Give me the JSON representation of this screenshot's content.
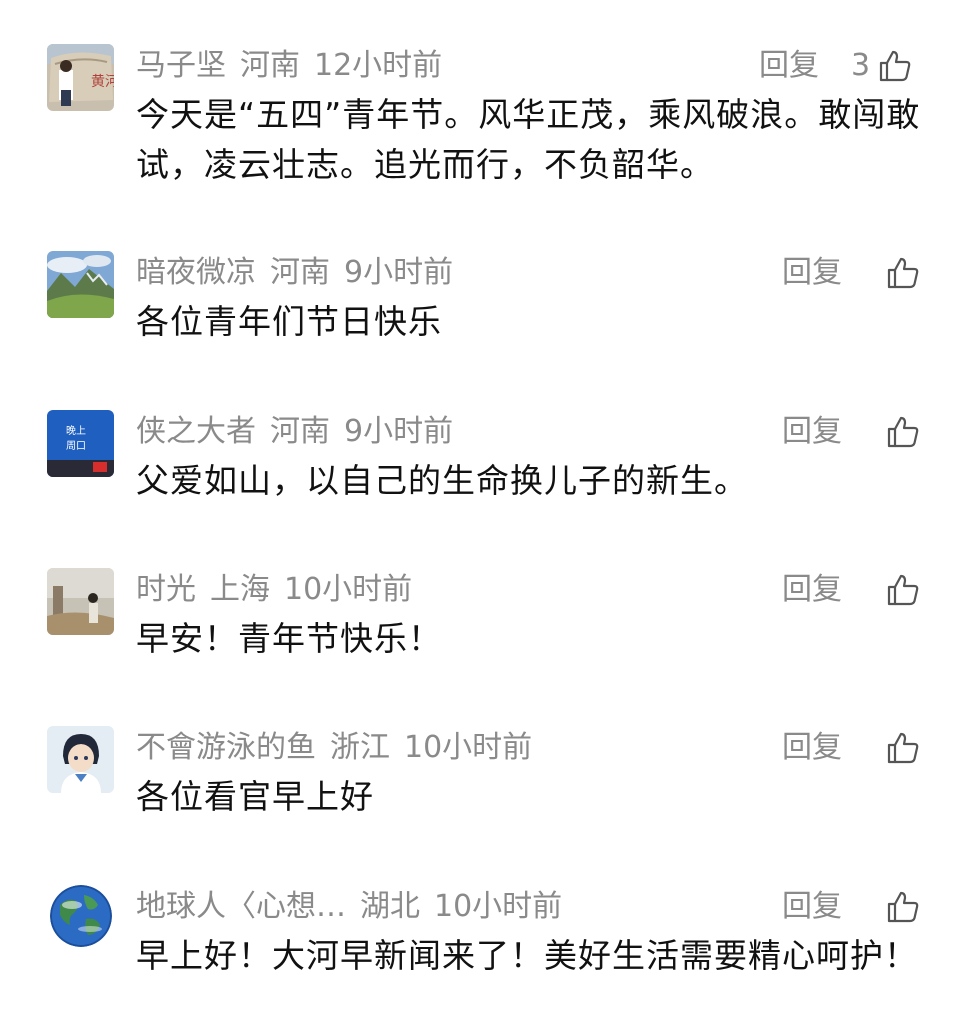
{
  "reply_label": "回复",
  "comments": [
    {
      "user": "马子坚",
      "location": "河南",
      "time": "12小时前",
      "likes": "3",
      "text": "今天是“五四”青年节。风华正茂，乘风破浪。敢闯敢试，凌云壮志。追光而行，不负韶华。",
      "avatar_icon": "stone-monument-avatar",
      "avatar_text": "黄河"
    },
    {
      "user": "暗夜微凉",
      "location": "河南",
      "time": "9小时前",
      "likes": "",
      "text": "各位青年们节日快乐",
      "avatar_icon": "landscape-avatar"
    },
    {
      "user": "侠之大者",
      "location": "河南",
      "time": "9小时前",
      "likes": "",
      "text": "父爱如山，以自己的生命换儿子的新生。",
      "avatar_icon": "news-badge-avatar",
      "avatar_text_1": "晚上",
      "avatar_text_2": "周口"
    },
    {
      "user": "时光",
      "location": "上海",
      "time": "10小时前",
      "likes": "",
      "text": "早安！青年节快乐！",
      "avatar_icon": "photo-avatar"
    },
    {
      "user": "不會游泳的鱼",
      "location": "浙江",
      "time": "10小时前",
      "likes": "",
      "text": "各位看官早上好",
      "avatar_icon": "anime-avatar"
    },
    {
      "user": "地球人〈心想…",
      "location": "湖北",
      "time": "10小时前",
      "likes": "",
      "text": "早上好！大河早新闻来了！美好生活需要精心呵护！",
      "avatar_icon": "earth-avatar"
    }
  ]
}
